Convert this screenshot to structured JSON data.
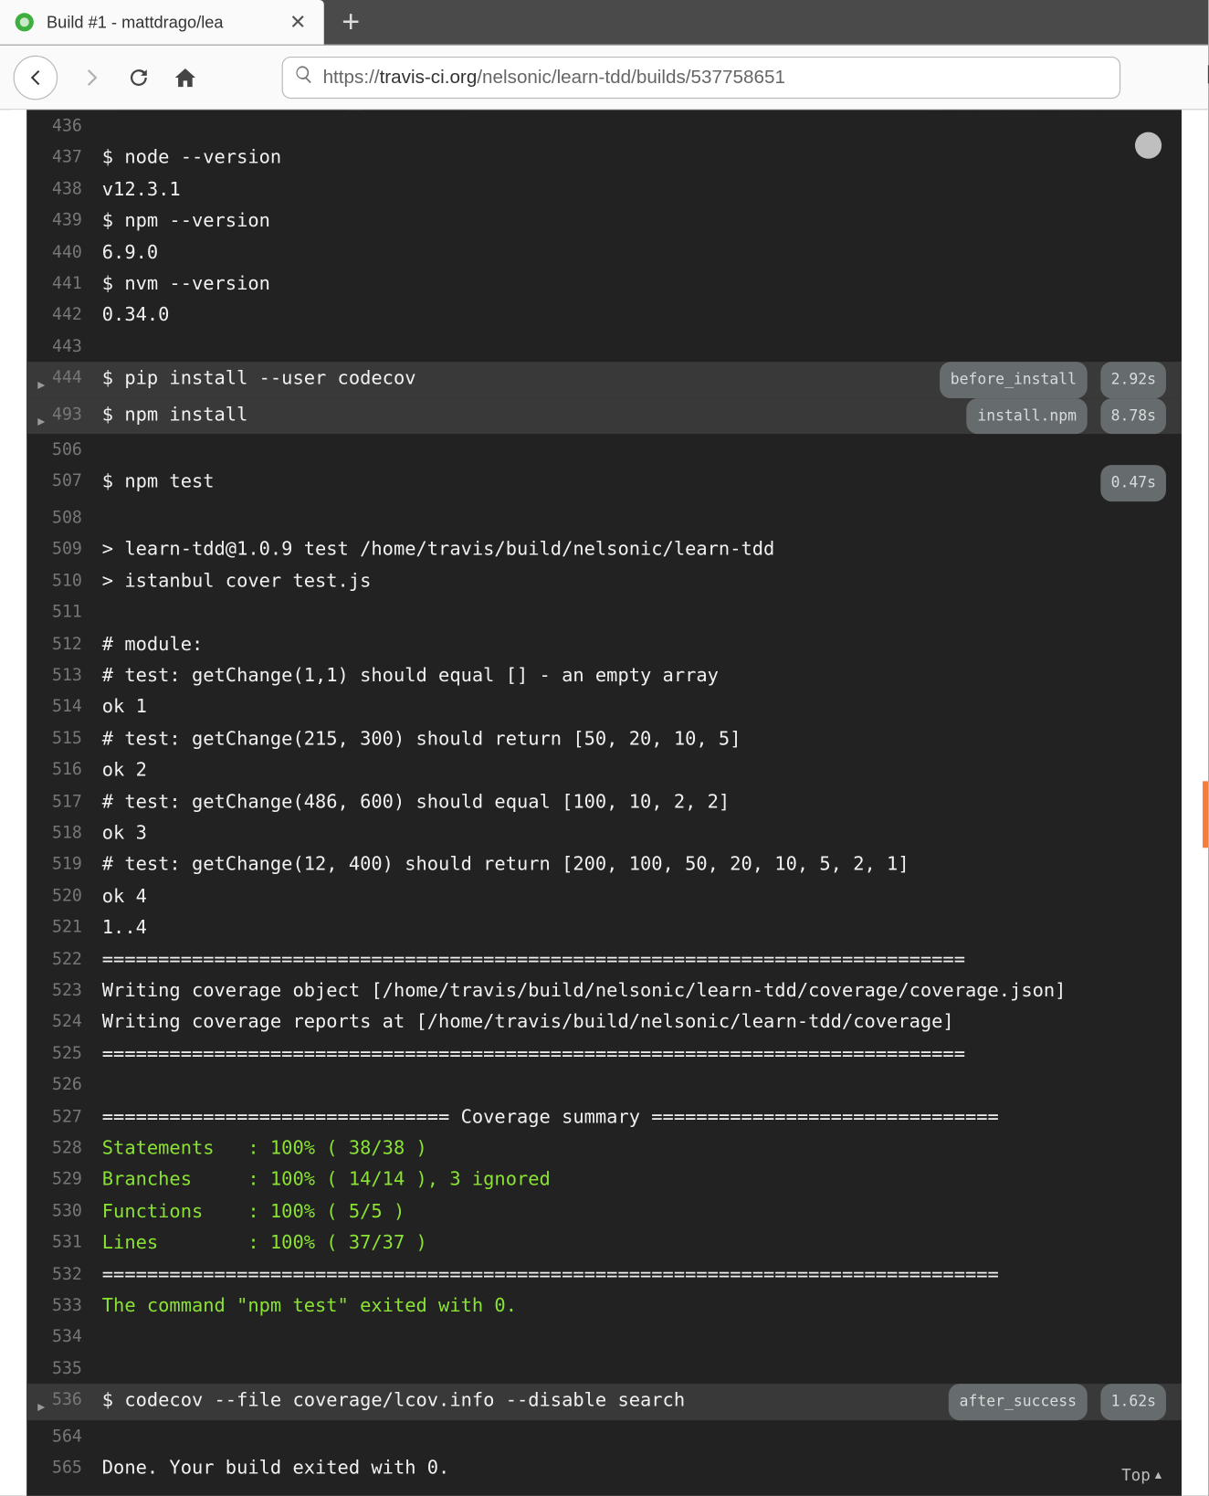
{
  "browser": {
    "tab_title": "Build #1 - mattdrago/lea",
    "url_prefix": "https://",
    "url_bold": "travis-ci.org",
    "url_rest": "/nelsonic/learn-tdd/builds/537758651"
  },
  "log": {
    "top_link": "Top",
    "lines": [
      {
        "n": "436",
        "t": "",
        "cls": ""
      },
      {
        "n": "437",
        "t": "$ node --version",
        "cls": ""
      },
      {
        "n": "438",
        "t": "v12.3.1",
        "cls": ""
      },
      {
        "n": "439",
        "t": "$ npm --version",
        "cls": ""
      },
      {
        "n": "440",
        "t": "6.9.0",
        "cls": ""
      },
      {
        "n": "441",
        "t": "$ nvm --version",
        "cls": ""
      },
      {
        "n": "442",
        "t": "0.34.0",
        "cls": ""
      },
      {
        "n": "443",
        "t": "",
        "cls": ""
      },
      {
        "n": "444",
        "t": "$ pip install --user codecov",
        "cls": "",
        "fold": true,
        "badge": "before_install",
        "dur": "2.92s"
      },
      {
        "n": "493",
        "t": "$ npm install",
        "cls": "",
        "fold": true,
        "badge": "install.npm",
        "dur": "8.78s"
      },
      {
        "n": "506",
        "t": "",
        "cls": ""
      },
      {
        "n": "507",
        "t": "$ npm test",
        "cls": "",
        "dur": "0.47s"
      },
      {
        "n": "508",
        "t": "",
        "cls": ""
      },
      {
        "n": "509",
        "t": "> learn-tdd@1.0.9 test /home/travis/build/nelsonic/learn-tdd",
        "cls": ""
      },
      {
        "n": "510",
        "t": "> istanbul cover test.js",
        "cls": ""
      },
      {
        "n": "511",
        "t": "",
        "cls": ""
      },
      {
        "n": "512",
        "t": "# module:",
        "cls": ""
      },
      {
        "n": "513",
        "t": "# test: getChange(1,1) should equal [] - an empty array",
        "cls": ""
      },
      {
        "n": "514",
        "t": "ok 1",
        "cls": ""
      },
      {
        "n": "515",
        "t": "# test: getChange(215, 300) should return [50, 20, 10, 5]",
        "cls": ""
      },
      {
        "n": "516",
        "t": "ok 2",
        "cls": ""
      },
      {
        "n": "517",
        "t": "# test: getChange(486, 600) should equal [100, 10, 2, 2]",
        "cls": ""
      },
      {
        "n": "518",
        "t": "ok 3",
        "cls": ""
      },
      {
        "n": "519",
        "t": "# test: getChange(12, 400) should return [200, 100, 50, 20, 10, 5, 2, 1]",
        "cls": ""
      },
      {
        "n": "520",
        "t": "ok 4",
        "cls": ""
      },
      {
        "n": "521",
        "t": "1..4",
        "cls": ""
      },
      {
        "n": "522",
        "t": "=============================================================================",
        "cls": ""
      },
      {
        "n": "523",
        "t": "Writing coverage object [/home/travis/build/nelsonic/learn-tdd/coverage/coverage.json]",
        "cls": ""
      },
      {
        "n": "524",
        "t": "Writing coverage reports at [/home/travis/build/nelsonic/learn-tdd/coverage]",
        "cls": ""
      },
      {
        "n": "525",
        "t": "=============================================================================",
        "cls": ""
      },
      {
        "n": "526",
        "t": "",
        "cls": ""
      },
      {
        "n": "527",
        "t": "=============================== Coverage summary ===============================",
        "cls": ""
      },
      {
        "n": "528",
        "t": "Statements   : 100% ( 38/38 )",
        "cls": "green"
      },
      {
        "n": "529",
        "t": "Branches     : 100% ( 14/14 ), 3 ignored",
        "cls": "green"
      },
      {
        "n": "530",
        "t": "Functions    : 100% ( 5/5 )",
        "cls": "green"
      },
      {
        "n": "531",
        "t": "Lines        : 100% ( 37/37 )",
        "cls": "green"
      },
      {
        "n": "532",
        "t": "================================================================================",
        "cls": ""
      },
      {
        "n": "533",
        "t": "The command \"npm test\" exited with 0.",
        "cls": "green"
      },
      {
        "n": "534",
        "t": "",
        "cls": ""
      },
      {
        "n": "535",
        "t": "",
        "cls": ""
      },
      {
        "n": "536",
        "t": "$ codecov --file coverage/lcov.info --disable search",
        "cls": "",
        "fold": true,
        "badge": "after_success",
        "dur": "1.62s"
      },
      {
        "n": "564",
        "t": "",
        "cls": ""
      },
      {
        "n": "565",
        "t": "Done. Your build exited with 0.",
        "cls": ""
      }
    ]
  }
}
